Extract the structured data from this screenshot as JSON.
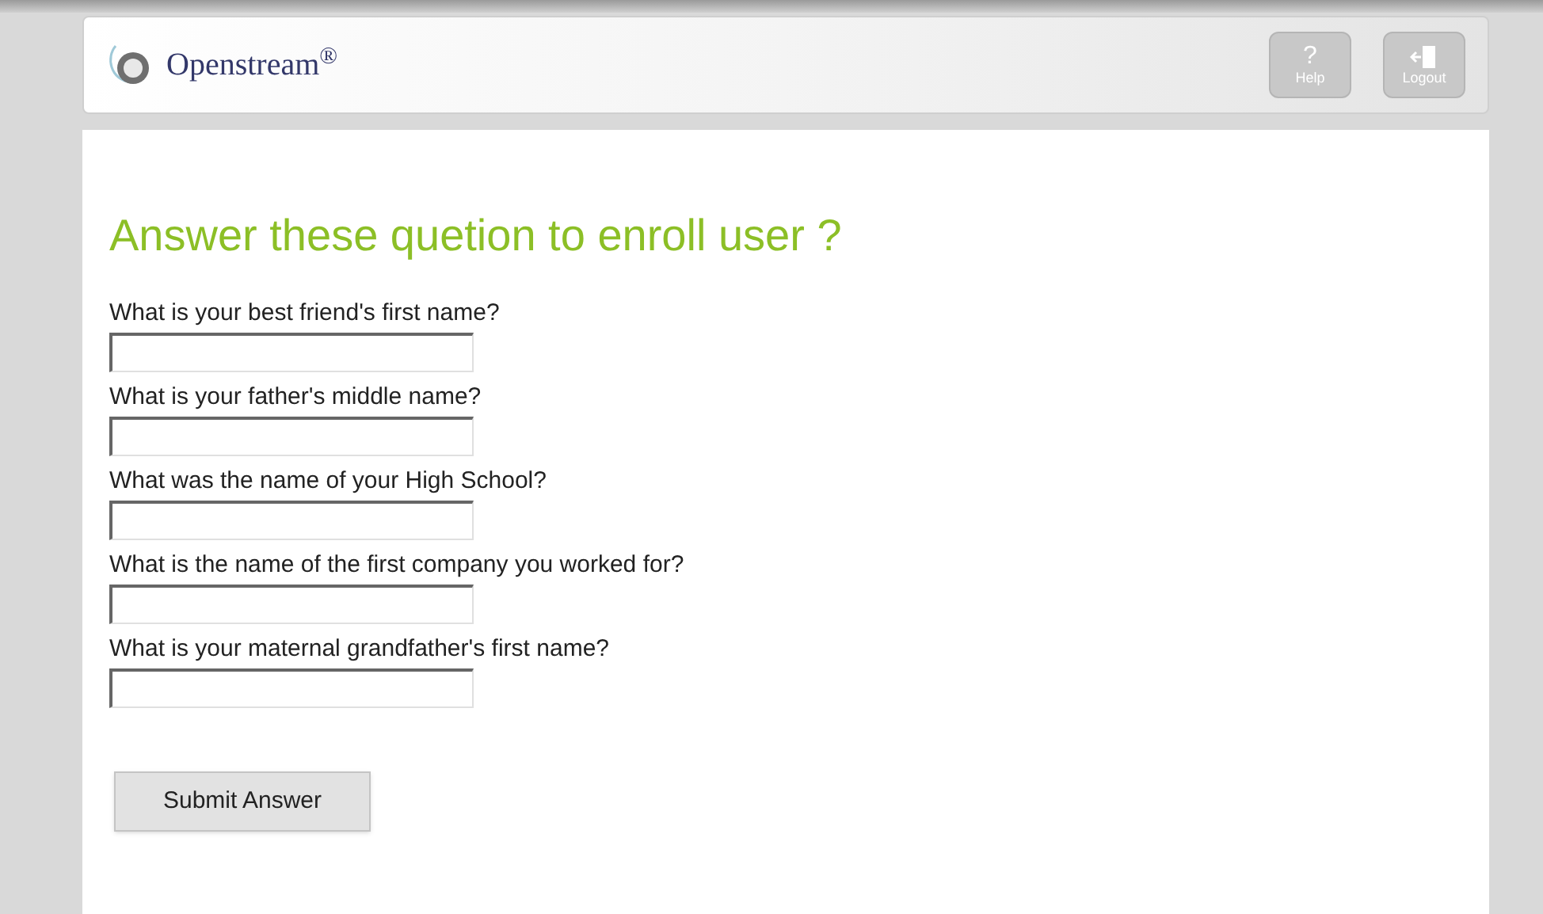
{
  "header": {
    "logo_text": "Openstream",
    "logo_mark": "®",
    "buttons": [
      {
        "kind": "help",
        "glyph": "?",
        "label": "Help"
      },
      {
        "kind": "logout",
        "label": "Logout"
      }
    ]
  },
  "heading": "Answer these quetion to enroll user ?",
  "questions": [
    {
      "label": "What is your best friend's first name?"
    },
    {
      "label": "What is your father's middle name?"
    },
    {
      "label": "What was the name of your High School?"
    },
    {
      "label": "What is the name of the first company you worked for?"
    },
    {
      "label": "What is your maternal grandfather's first name?"
    }
  ],
  "submit": "Submit Answer"
}
